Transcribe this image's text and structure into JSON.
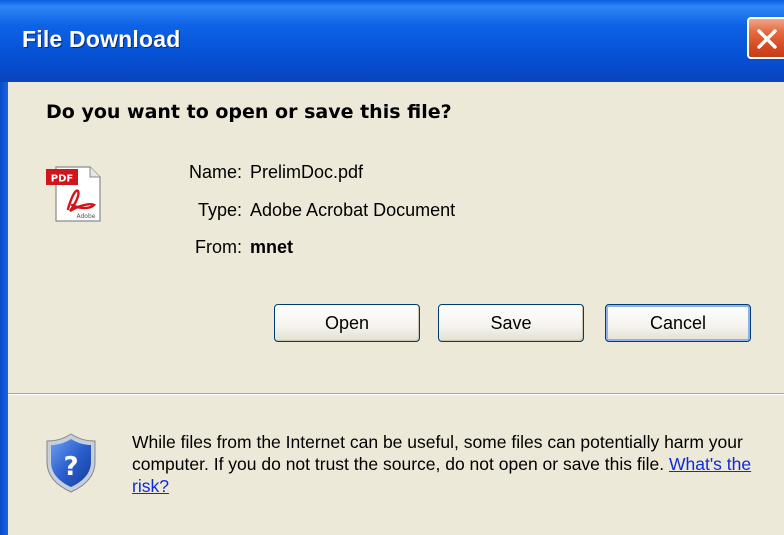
{
  "window": {
    "title": "File Download"
  },
  "dialog": {
    "question": "Do you want to open or save this file?",
    "file": {
      "name_label": "Name:",
      "name_value": "PrelimDoc.pdf",
      "type_label": "Type:",
      "type_value": "Adobe Acrobat Document",
      "from_label": "From:",
      "from_value": "mnet",
      "icon": "pdf-file-icon"
    },
    "buttons": {
      "open": "Open",
      "save": "Save",
      "cancel": "Cancel"
    },
    "warning": {
      "text": "While files from the Internet can be useful, some files can potentially harm your computer. If you do not trust the source, do not open or save this file.",
      "link": "What's the risk?",
      "icon": "security-shield-icon"
    }
  },
  "colors": {
    "titlebar": "#0754d8",
    "face": "#ece9d8",
    "close": "#d4481f",
    "link": "#0b2cd6"
  }
}
